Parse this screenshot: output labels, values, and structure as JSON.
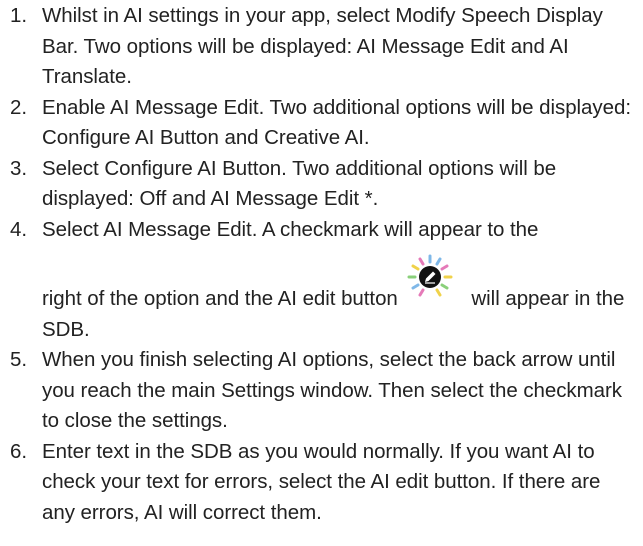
{
  "steps": [
    {
      "number": "1.",
      "text": "Whilst in AI settings in your app, select Modify Speech Display Bar. Two options will be displayed: AI Message Edit and AI Translate."
    },
    {
      "number": "2.",
      "text": "Enable AI Message Edit. Two additional options will be displayed: Configure AI Button and Creative AI."
    },
    {
      "number": "3.",
      "text": "Select Configure AI Button. Two additional options will be displayed: Off and AI Message Edit *."
    },
    {
      "number": "4.",
      "text_before": "Select AI Message Edit. A checkmark will appear to the",
      "text_mid": "right of the option and the AI edit button",
      "text_after": " will appear in the SDB.",
      "icon": "ai-edit-button-icon"
    },
    {
      "number": "5.",
      "text": "When you finish selecting AI options, select the back arrow until you reach the main Settings window. Then select the checkmark to close the settings."
    },
    {
      "number": "6.",
      "text": "Enter text in the SDB as you would normally. If you want AI to check your text for errors, select the AI edit button. If there are any errors, AI will correct them."
    }
  ],
  "colors": {
    "text": "#222222",
    "icon_circle": "#111111",
    "icon_blue": "#7fb8e8",
    "icon_pink": "#e57ab8",
    "icon_yellow": "#f0d24a",
    "icon_green": "#8ad07a"
  }
}
